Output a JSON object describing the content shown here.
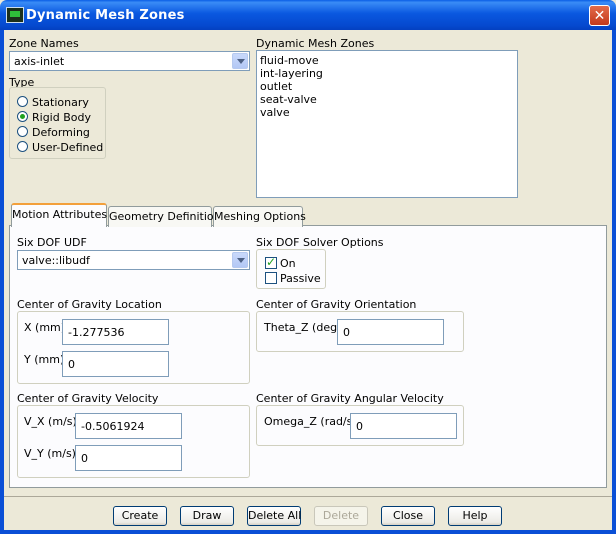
{
  "window": {
    "title": "Dynamic Mesh Zones",
    "close_glyph": "✕"
  },
  "zone_names": {
    "label": "Zone Names",
    "selected": "axis-inlet"
  },
  "type": {
    "label": "Type",
    "options": [
      {
        "label": "Stationary",
        "selected": false
      },
      {
        "label": "Rigid Body",
        "selected": true
      },
      {
        "label": "Deforming",
        "selected": false
      },
      {
        "label": "User-Defined",
        "selected": false
      }
    ]
  },
  "dynamic_mesh_zones": {
    "label": "Dynamic Mesh Zones",
    "items": [
      "fluid-move",
      "int-layering",
      "outlet",
      "seat-valve",
      "valve"
    ]
  },
  "tabs": [
    {
      "label": "Motion Attributes",
      "active": true
    },
    {
      "label": "Geometry Definition",
      "active": false
    },
    {
      "label": "Meshing Options",
      "active": false
    }
  ],
  "motion": {
    "six_dof_udf": {
      "label": "Six DOF UDF",
      "selected": "valve::libudf"
    },
    "solver_options": {
      "label": "Six DOF Solver Options",
      "on": {
        "label": "On",
        "checked": true
      },
      "passive": {
        "label": "Passive",
        "checked": false
      }
    },
    "cg_location": {
      "label": "Center of Gravity Location",
      "x_label": "X (mm)",
      "x_value": "-1.277536",
      "y_label": "Y (mm)",
      "y_value": "0"
    },
    "cg_orientation": {
      "label": "Center of Gravity Orientation",
      "theta_label": "Theta_Z (deg)",
      "theta_value": "0"
    },
    "cg_velocity": {
      "label": "Center of Gravity Velocity",
      "vx_label": "V_X (m/s)",
      "vx_value": "-0.5061924",
      "vy_label": "V_Y (m/s)",
      "vy_value": "0"
    },
    "cg_angular_velocity": {
      "label": "Center of Gravity Angular Velocity",
      "omega_label": "Omega_Z (rad/s)",
      "omega_value": "0"
    }
  },
  "buttons": {
    "create": "Create",
    "draw": "Draw",
    "delete_all": "Delete All",
    "delete": "Delete",
    "close": "Close",
    "help": "Help"
  }
}
